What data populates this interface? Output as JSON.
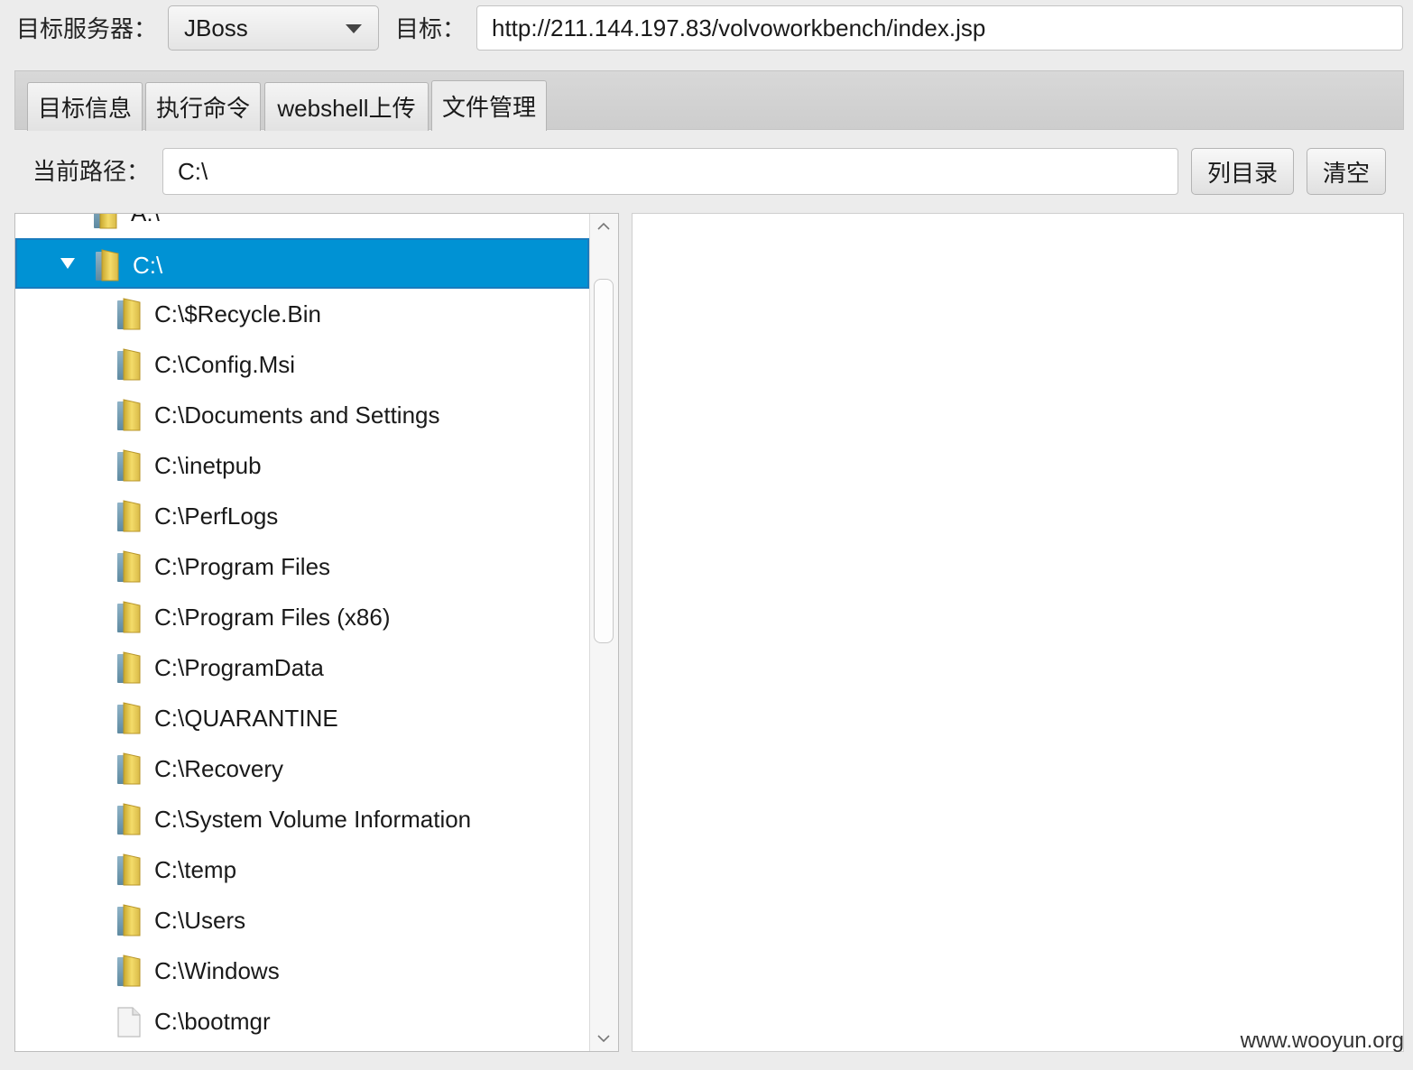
{
  "top_bar": {
    "server_label": "目标服务器：",
    "server_value": "JBoss",
    "target_label": "目标：",
    "target_url": "http://211.144.197.83/volvoworkbench/index.jsp"
  },
  "tabs": [
    {
      "label": "目标信息"
    },
    {
      "label": "执行命令"
    },
    {
      "label": "webshell上传"
    },
    {
      "label": "文件管理",
      "active": true
    }
  ],
  "path_bar": {
    "label": "当前路径：",
    "value": "C:\\",
    "list_button": "列目录",
    "clear_button": "清空"
  },
  "tree": {
    "partial_top": "A:\\",
    "selected": "C:\\",
    "children": [
      {
        "label": "C:\\$Recycle.Bin",
        "icon": "folder-icon"
      },
      {
        "label": "C:\\Config.Msi",
        "icon": "folder-icon"
      },
      {
        "label": "C:\\Documents and Settings",
        "icon": "folder-icon"
      },
      {
        "label": "C:\\inetpub",
        "icon": "folder-icon"
      },
      {
        "label": "C:\\PerfLogs",
        "icon": "folder-icon"
      },
      {
        "label": "C:\\Program Files",
        "icon": "folder-icon"
      },
      {
        "label": "C:\\Program Files (x86)",
        "icon": "folder-icon"
      },
      {
        "label": "C:\\ProgramData",
        "icon": "folder-icon"
      },
      {
        "label": "C:\\QUARANTINE",
        "icon": "folder-icon"
      },
      {
        "label": "C:\\Recovery",
        "icon": "folder-icon"
      },
      {
        "label": "C:\\System Volume Information",
        "icon": "folder-icon"
      },
      {
        "label": "C:\\temp",
        "icon": "folder-icon"
      },
      {
        "label": "C:\\Users",
        "icon": "folder-icon"
      },
      {
        "label": "C:\\Windows",
        "icon": "folder-icon"
      },
      {
        "label": "C:\\bootmgr",
        "icon": "file-icon"
      }
    ]
  },
  "watermark": "www.wooyun.org",
  "colors": {
    "selection": "#0092d4",
    "folder": "#e8c84a"
  }
}
